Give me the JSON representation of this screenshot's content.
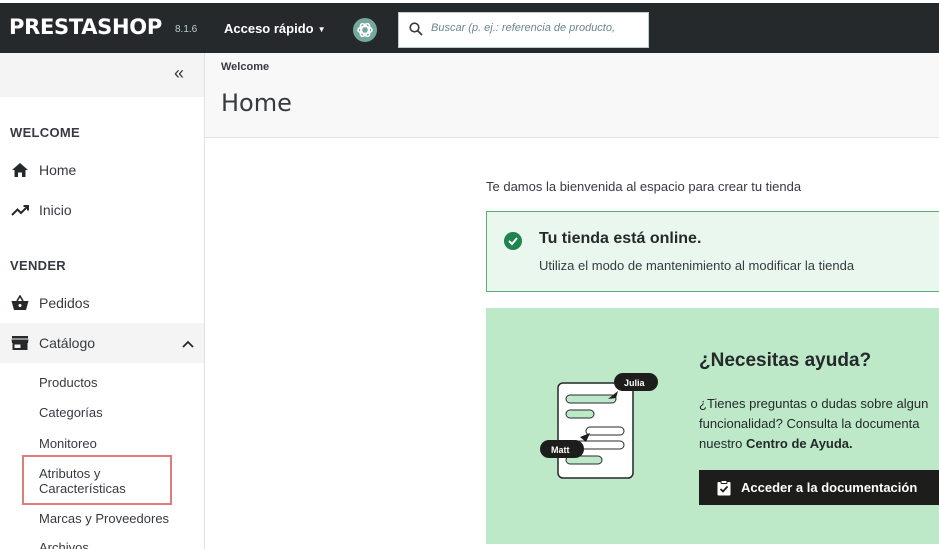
{
  "header": {
    "logo": "PRESTASHOP",
    "version": "8.1.6",
    "quick_access": "Acceso rápido",
    "search_placeholder": "Buscar (p. ej.: referencia de producto,"
  },
  "sidebar": {
    "collapse_label": "«",
    "sections": {
      "welcome": "WELCOME",
      "sell": "VENDER"
    },
    "items": {
      "home": "Home",
      "inicio": "Inicio",
      "pedidos": "Pedidos",
      "catalogo": "Catálogo"
    },
    "catalog_sub": [
      "Productos",
      "Categorías",
      "Monitoreo",
      "Atributos y",
      "Características",
      "Marcas y Proveedores",
      "Archivos"
    ]
  },
  "page": {
    "breadcrumb": "Welcome",
    "title": "Home",
    "welcome_text": "Te damos la bienvenida al espacio para crear tu tienda"
  },
  "online_card": {
    "title": "Tu tienda está online.",
    "desc": "Utiliza el modo de mantenimiento al modificar la tienda"
  },
  "help_card": {
    "title": "¿Necesitas ayuda?",
    "line1": "¿Tienes preguntas o dudas sobre algun",
    "line2": "funcionalidad? Consulta la documenta",
    "line3_prefix": "nuestro ",
    "line3_bold": "Centro de Ayuda.",
    "button": "Acceder a la documentación",
    "bubble_julia": "Julia",
    "bubble_matt": "Matt"
  },
  "colors": {
    "topbar": "#25292b",
    "online_bg": "#eaf7ee",
    "online_border": "#53b176",
    "help_bg": "#bde9c9",
    "highlight": "#e07b7b"
  }
}
